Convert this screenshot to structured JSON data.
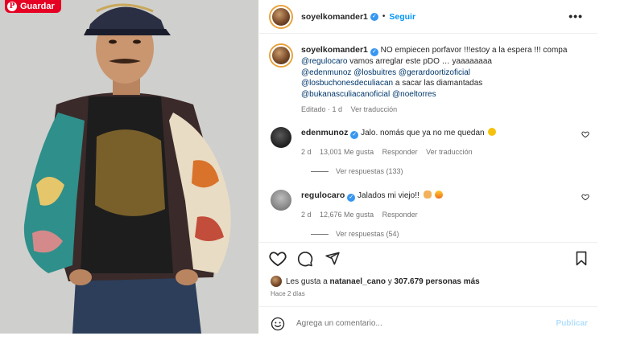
{
  "pin": {
    "save_label": "Guardar",
    "pin_glyph": "P"
  },
  "header": {
    "username": "soyelkomander1",
    "verified_glyph": "✓",
    "separator": "•",
    "follow_label": "Seguir",
    "more_glyph": "•••"
  },
  "caption": {
    "username": "soyelkomander1",
    "text_1": "NO empiecen porfavor !!!estoy a la espera !!! compa",
    "mention_1": "@regulocaro",
    "text_2": "vamos arreglar este pDO … yaaaaaaaa",
    "mentions_line_1": "@edenmunoz @losbuitres @gerardoortizoficial",
    "mention_2": "@losbuchonesdeculiacan",
    "text_3": "a sacar las diamantadas",
    "mentions_line_2": "@bukanasculiacanoficial @noeltorres",
    "edited": "Editado · 1 d",
    "translate": "Ver traducción"
  },
  "comments": [
    {
      "username": "edenmunoz",
      "text": "Jalo. nomás que ya no me quedan",
      "emoji": "grinning-sweat-emoji",
      "time": "2 d",
      "likes": "13,001 Me gusta",
      "reply": "Responder",
      "translate": "Ver traducción",
      "view_replies": "Ver respuestas (133)"
    },
    {
      "username": "regulocaro",
      "text": "Jalados mi viejo!!",
      "emoji": "raised-hands-emoji",
      "emoji_2": "fire-emoji",
      "time": "2 d",
      "likes": "12,676 Me gusta",
      "reply": "Responder",
      "view_replies": "Ver respuestas (54)"
    }
  ],
  "likes": {
    "prefix": "Les gusta a",
    "user": "natanael_cano",
    "middle": "y",
    "count": "307.679 personas más"
  },
  "time_ago": "Hace 2 días",
  "composer": {
    "placeholder": "Agrega un comentario...",
    "publish_label": "Publicar"
  },
  "colors": {
    "link": "#00376b",
    "follow": "#0095f6",
    "verified": "#3897f0",
    "pinterest": "#e60023",
    "publish_disabled": "#b2dffc"
  }
}
